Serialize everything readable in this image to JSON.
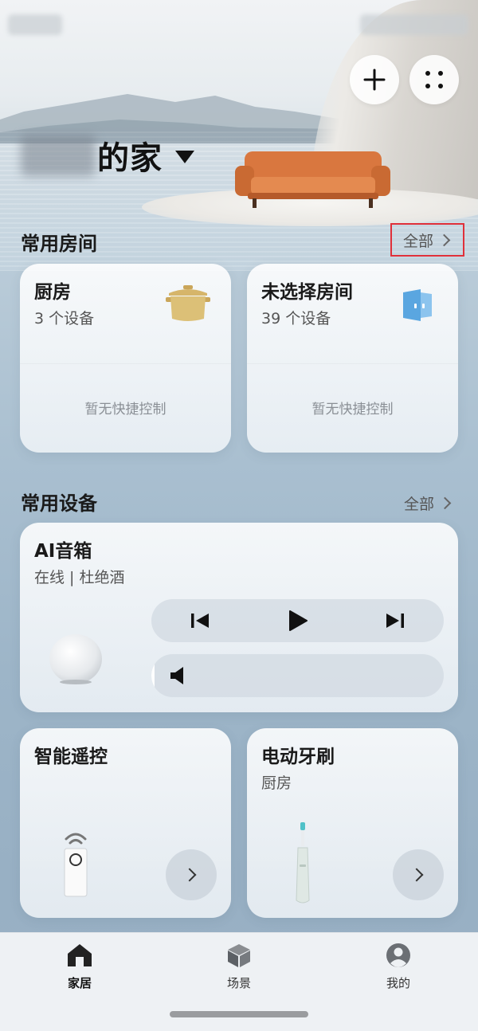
{
  "header": {
    "home_title": "的家",
    "add_button_label": "+",
    "menu_button_label": "more"
  },
  "rooms_section": {
    "title": "常用房间",
    "see_all_label": "全部",
    "rooms": [
      {
        "name": "厨房",
        "device_count": "3 个设备",
        "empty_text": "暂无快捷控制",
        "icon": "pot-icon",
        "icon_color": "#d6b56a"
      },
      {
        "name": "未选择房间",
        "device_count": "39 个设备",
        "empty_text": "暂无快捷控制",
        "icon": "door-icon",
        "icon_color": "#5aa6e0"
      }
    ]
  },
  "devices_section": {
    "title": "常用设备",
    "see_all_label": "全部",
    "speaker": {
      "name": "AI音箱",
      "status": "在线 | 杜绝酒",
      "volume": 0.0
    },
    "devices": [
      {
        "name": "智能遥控",
        "room": ""
      },
      {
        "name": "电动牙刷",
        "room": "厨房"
      }
    ]
  },
  "tabbar": {
    "tabs": [
      {
        "label": "家居",
        "active": true
      },
      {
        "label": "场景",
        "active": false
      },
      {
        "label": "我的",
        "active": false
      }
    ]
  }
}
